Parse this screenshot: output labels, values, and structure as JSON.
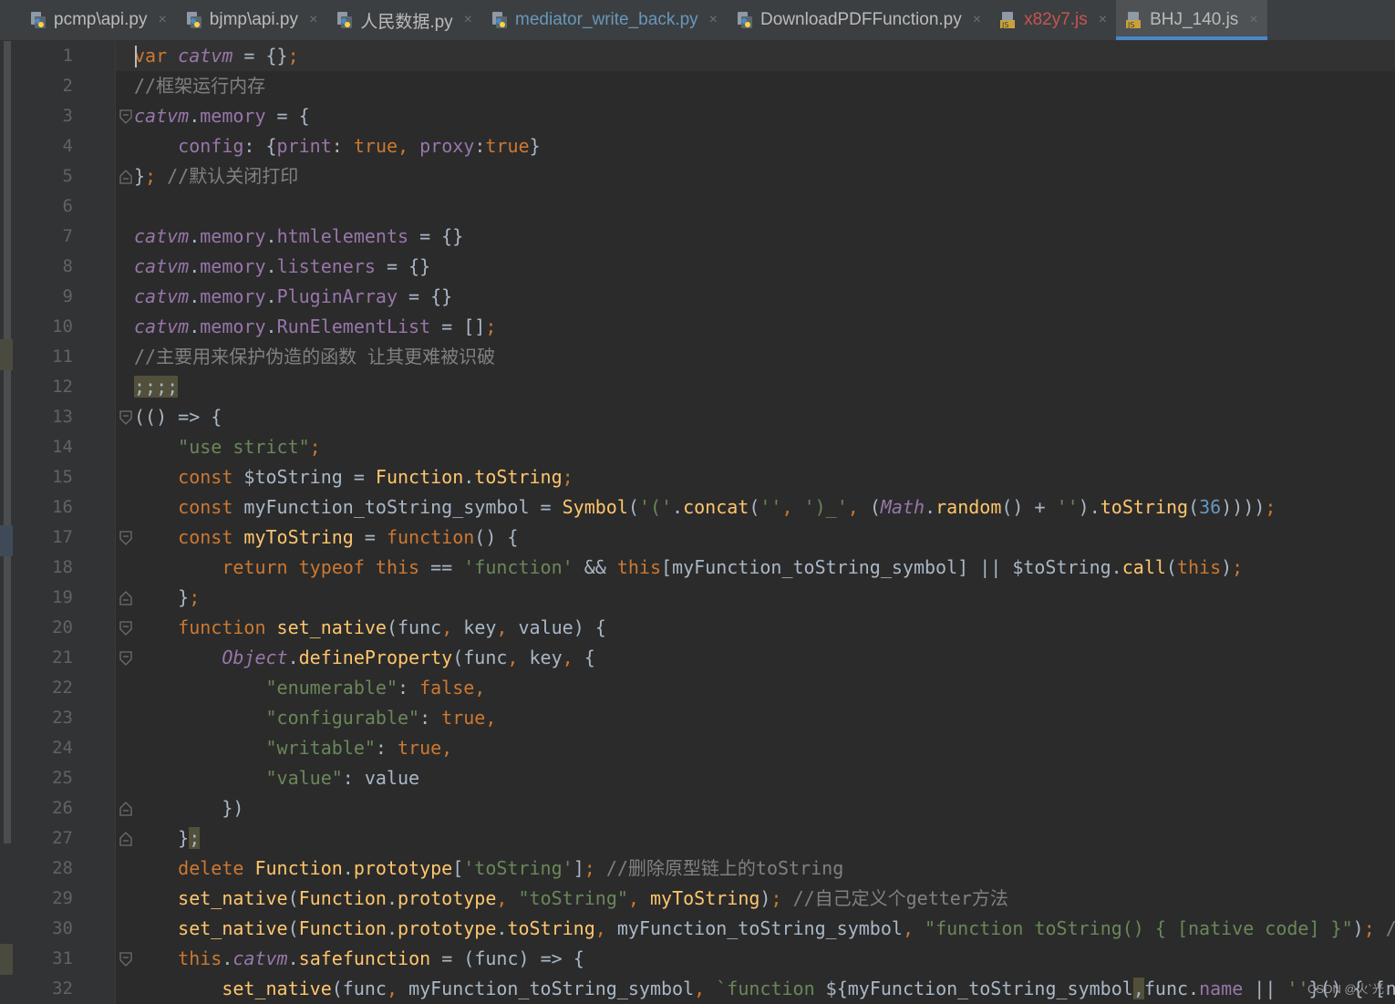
{
  "editor": {
    "colors": {
      "background": "#2b2b2b",
      "keyword": "#cc7832",
      "string": "#6a8759",
      "comment": "#808080",
      "global": "#9876aa",
      "function": "#ffc66d",
      "number": "#6897bb",
      "plain": "#a9b7c6",
      "active_tab_underline": "#4a88c7"
    },
    "tabs": [
      {
        "label": "pcmp\\api.py",
        "icon": "python-file-icon",
        "color": "#bbbbbb",
        "active": false
      },
      {
        "label": "bjmp\\api.py",
        "icon": "python-file-icon",
        "color": "#bbbbbb",
        "active": false
      },
      {
        "label": "人民数据.py",
        "icon": "python-file-icon",
        "color": "#bbbbbb",
        "active": false
      },
      {
        "label": "mediator_write_back.py",
        "icon": "python-file-icon",
        "color": "#6897bb",
        "active": false
      },
      {
        "label": "DownloadPDFFunction.py",
        "icon": "python-file-icon",
        "color": "#bbbbbb",
        "active": false
      },
      {
        "label": "x82y7.js",
        "icon": "javascript-file-icon",
        "color": "#c75450",
        "active": false
      },
      {
        "label": "BHJ_140.js",
        "icon": "javascript-file-icon",
        "color": "#bbbbbb",
        "active": true
      }
    ],
    "close_glyph": "×",
    "line_numbers": [
      "1",
      "2",
      "3",
      "4",
      "5",
      "6",
      "7",
      "8",
      "9",
      "10",
      "11",
      "12",
      "13",
      "14",
      "15",
      "16",
      "17",
      "18",
      "19",
      "20",
      "21",
      "22",
      "23",
      "24",
      "25",
      "26",
      "27",
      "28",
      "29",
      "30",
      "31",
      "32"
    ],
    "lines": [
      [
        [
          "k",
          "var"
        ],
        [
          "p",
          " "
        ],
        [
          "g",
          "catvm"
        ],
        [
          "p",
          " = {}"
        ],
        [
          "k",
          ";"
        ]
      ],
      [
        [
          "c",
          "//框架运行内存"
        ]
      ],
      [
        [
          "g",
          "catvm"
        ],
        [
          "p",
          "."
        ],
        [
          "gp",
          "memory"
        ],
        [
          "p",
          " = {"
        ]
      ],
      [
        [
          "p",
          "    "
        ],
        [
          "gp",
          "config"
        ],
        [
          "p",
          ": {"
        ],
        [
          "gp",
          "print"
        ],
        [
          "p",
          ": "
        ],
        [
          "k",
          "true"
        ],
        [
          "k",
          ", "
        ],
        [
          "gp",
          "proxy"
        ],
        [
          "p",
          ":"
        ],
        [
          "k",
          "true"
        ],
        [
          "p",
          "}"
        ]
      ],
      [
        [
          "p",
          "}"
        ],
        [
          "k",
          ";"
        ],
        [
          "p",
          " "
        ],
        [
          "c",
          "//默认关闭打印"
        ]
      ],
      [],
      [
        [
          "g",
          "catvm"
        ],
        [
          "p",
          "."
        ],
        [
          "gp",
          "memory"
        ],
        [
          "p",
          "."
        ],
        [
          "gp",
          "htmlelements"
        ],
        [
          "p",
          " = {}"
        ]
      ],
      [
        [
          "g",
          "catvm"
        ],
        [
          "p",
          "."
        ],
        [
          "gp",
          "memory"
        ],
        [
          "p",
          "."
        ],
        [
          "gp",
          "listeners"
        ],
        [
          "p",
          " = {}"
        ]
      ],
      [
        [
          "g",
          "catvm"
        ],
        [
          "p",
          "."
        ],
        [
          "gp",
          "memory"
        ],
        [
          "p",
          "."
        ],
        [
          "gp",
          "PluginArray"
        ],
        [
          "p",
          " = {}"
        ]
      ],
      [
        [
          "g",
          "catvm"
        ],
        [
          "p",
          "."
        ],
        [
          "gp",
          "memory"
        ],
        [
          "p",
          "."
        ],
        [
          "gp",
          "RunElementList"
        ],
        [
          "p",
          " = []"
        ],
        [
          "k",
          ";"
        ]
      ],
      [
        [
          "c",
          "//主要用来保护伪造的函数 让其更难被识破"
        ]
      ],
      [
        [
          "hl",
          ";;;;"
        ]
      ],
      [
        [
          "p",
          "(() => {"
        ]
      ],
      [
        [
          "p",
          "    "
        ],
        [
          "s",
          "\"use strict\""
        ],
        [
          "k",
          ";"
        ]
      ],
      [
        [
          "p",
          "    "
        ],
        [
          "k",
          "const "
        ],
        [
          "p",
          "$toString = "
        ],
        [
          "f",
          "Function"
        ],
        [
          "p",
          "."
        ],
        [
          "f",
          "toString"
        ],
        [
          "k",
          ";"
        ]
      ],
      [
        [
          "p",
          "    "
        ],
        [
          "k",
          "const "
        ],
        [
          "p",
          "myFunction_toString_symbol = "
        ],
        [
          "f",
          "Symbol"
        ],
        [
          "p",
          "("
        ],
        [
          "s",
          "'('"
        ],
        [
          "p",
          "."
        ],
        [
          "f",
          "concat"
        ],
        [
          "p",
          "("
        ],
        [
          "s",
          "''"
        ],
        [
          "k",
          ", "
        ],
        [
          "s",
          "')_'"
        ],
        [
          "k",
          ", "
        ],
        [
          "p",
          "("
        ],
        [
          "g",
          "Math"
        ],
        [
          "p",
          "."
        ],
        [
          "f",
          "random"
        ],
        [
          "p",
          "() + "
        ],
        [
          "s",
          "''"
        ],
        [
          "p",
          ")."
        ],
        [
          "f",
          "toString"
        ],
        [
          "p",
          "("
        ],
        [
          "n",
          "36"
        ],
        [
          "p",
          "))))"
        ],
        [
          "k",
          ";"
        ]
      ],
      [
        [
          "p",
          "    "
        ],
        [
          "k",
          "const "
        ],
        [
          "f",
          "myToString"
        ],
        [
          "p",
          " = "
        ],
        [
          "k",
          "function"
        ],
        [
          "p",
          "() {"
        ]
      ],
      [
        [
          "p",
          "        "
        ],
        [
          "k",
          "return typeof this "
        ],
        [
          "p",
          "== "
        ],
        [
          "s",
          "'function'"
        ],
        [
          "p",
          " && "
        ],
        [
          "k",
          "this"
        ],
        [
          "p",
          "[myFunction_toString_symbol] || $toString."
        ],
        [
          "f",
          "call"
        ],
        [
          "p",
          "("
        ],
        [
          "k",
          "this"
        ],
        [
          "p",
          ")"
        ],
        [
          "k",
          ";"
        ]
      ],
      [
        [
          "p",
          "    }"
        ],
        [
          "k",
          ";"
        ]
      ],
      [
        [
          "p",
          "    "
        ],
        [
          "k",
          "function "
        ],
        [
          "f",
          "set_native"
        ],
        [
          "p",
          "(func"
        ],
        [
          "k",
          ", "
        ],
        [
          "p",
          "key"
        ],
        [
          "k",
          ", "
        ],
        [
          "p",
          "value) {"
        ]
      ],
      [
        [
          "p",
          "        "
        ],
        [
          "g",
          "Object"
        ],
        [
          "p",
          "."
        ],
        [
          "f",
          "defineProperty"
        ],
        [
          "p",
          "(func"
        ],
        [
          "k",
          ", "
        ],
        [
          "p",
          "key"
        ],
        [
          "k",
          ", "
        ],
        [
          "p",
          "{"
        ]
      ],
      [
        [
          "p",
          "            "
        ],
        [
          "s",
          "\"enumerable\""
        ],
        [
          "p",
          ": "
        ],
        [
          "k",
          "false,"
        ]
      ],
      [
        [
          "p",
          "            "
        ],
        [
          "s",
          "\"configurable\""
        ],
        [
          "p",
          ": "
        ],
        [
          "k",
          "true,"
        ]
      ],
      [
        [
          "p",
          "            "
        ],
        [
          "s",
          "\"writable\""
        ],
        [
          "p",
          ": "
        ],
        [
          "k",
          "true,"
        ]
      ],
      [
        [
          "p",
          "            "
        ],
        [
          "s",
          "\"value\""
        ],
        [
          "p",
          ": value"
        ]
      ],
      [
        [
          "p",
          "        })"
        ]
      ],
      [
        [
          "p",
          "    }"
        ],
        [
          "hl",
          ";"
        ]
      ],
      [
        [
          "p",
          "    "
        ],
        [
          "k",
          "delete "
        ],
        [
          "f",
          "Function"
        ],
        [
          "p",
          "."
        ],
        [
          "f",
          "prototype"
        ],
        [
          "p",
          "["
        ],
        [
          "s",
          "'toString'"
        ],
        [
          "p",
          "]"
        ],
        [
          "k",
          ";"
        ],
        [
          "p",
          " "
        ],
        [
          "c",
          "//删除原型链上的toString"
        ]
      ],
      [
        [
          "p",
          "    "
        ],
        [
          "f",
          "set_native"
        ],
        [
          "p",
          "("
        ],
        [
          "f",
          "Function"
        ],
        [
          "p",
          "."
        ],
        [
          "f",
          "prototype"
        ],
        [
          "k",
          ", "
        ],
        [
          "s",
          "\"toString\""
        ],
        [
          "k",
          ", "
        ],
        [
          "f",
          "myToString"
        ],
        [
          "p",
          ")"
        ],
        [
          "k",
          ";"
        ],
        [
          "p",
          " "
        ],
        [
          "c",
          "//自己定义个getter方法"
        ]
      ],
      [
        [
          "p",
          "    "
        ],
        [
          "f",
          "set_native"
        ],
        [
          "p",
          "("
        ],
        [
          "f",
          "Function"
        ],
        [
          "p",
          "."
        ],
        [
          "f",
          "prototype"
        ],
        [
          "p",
          "."
        ],
        [
          "f",
          "toString"
        ],
        [
          "k",
          ", "
        ],
        [
          "p",
          "myFunction_toString_symbol"
        ],
        [
          "k",
          ", "
        ],
        [
          "s",
          "\"function toString() { [native code] }\""
        ],
        [
          "p",
          ")"
        ],
        [
          "k",
          ";"
        ],
        [
          "p",
          " "
        ],
        [
          "c",
          "//"
        ]
      ],
      [
        [
          "p",
          "    "
        ],
        [
          "k",
          "this"
        ],
        [
          "p",
          "."
        ],
        [
          "g",
          "catvm"
        ],
        [
          "p",
          "."
        ],
        [
          "f",
          "safefunction"
        ],
        [
          "p",
          " = (func) => {"
        ]
      ],
      [
        [
          "p",
          "        "
        ],
        [
          "f",
          "set_native"
        ],
        [
          "p",
          "(func"
        ],
        [
          "k",
          ", "
        ],
        [
          "p",
          "myFunction_toString_symbol"
        ],
        [
          "k",
          ", "
        ],
        [
          "s",
          "`function "
        ],
        [
          "p",
          "${myFunction_toString_symbol"
        ],
        [
          "hl",
          ","
        ],
        [
          "p",
          "func."
        ],
        [
          "gp",
          "name"
        ],
        [
          "p",
          " || "
        ],
        [
          "s",
          "''"
        ],
        [
          "p",
          "}() { [na"
        ]
      ]
    ],
    "folds": [
      3,
      5,
      13,
      17,
      19,
      20,
      21,
      26,
      27,
      31
    ],
    "watermark": "CSDN @火`光"
  }
}
